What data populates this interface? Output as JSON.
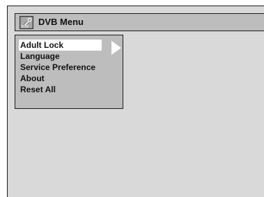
{
  "window": {
    "title": "DVB Menu",
    "icon": "dvb-settings-icon"
  },
  "menu": {
    "selected_index": 0,
    "items": [
      {
        "label": "Adult Lock"
      },
      {
        "label": "Language"
      },
      {
        "label": "Service Preference"
      },
      {
        "label": "About"
      },
      {
        "label": "Reset All"
      }
    ]
  },
  "colors": {
    "background": "#d9d9d9",
    "title_bar": "#bdbdbd",
    "panel": "#bdbdbd",
    "highlight": "#ffffff",
    "text": "#111111"
  }
}
